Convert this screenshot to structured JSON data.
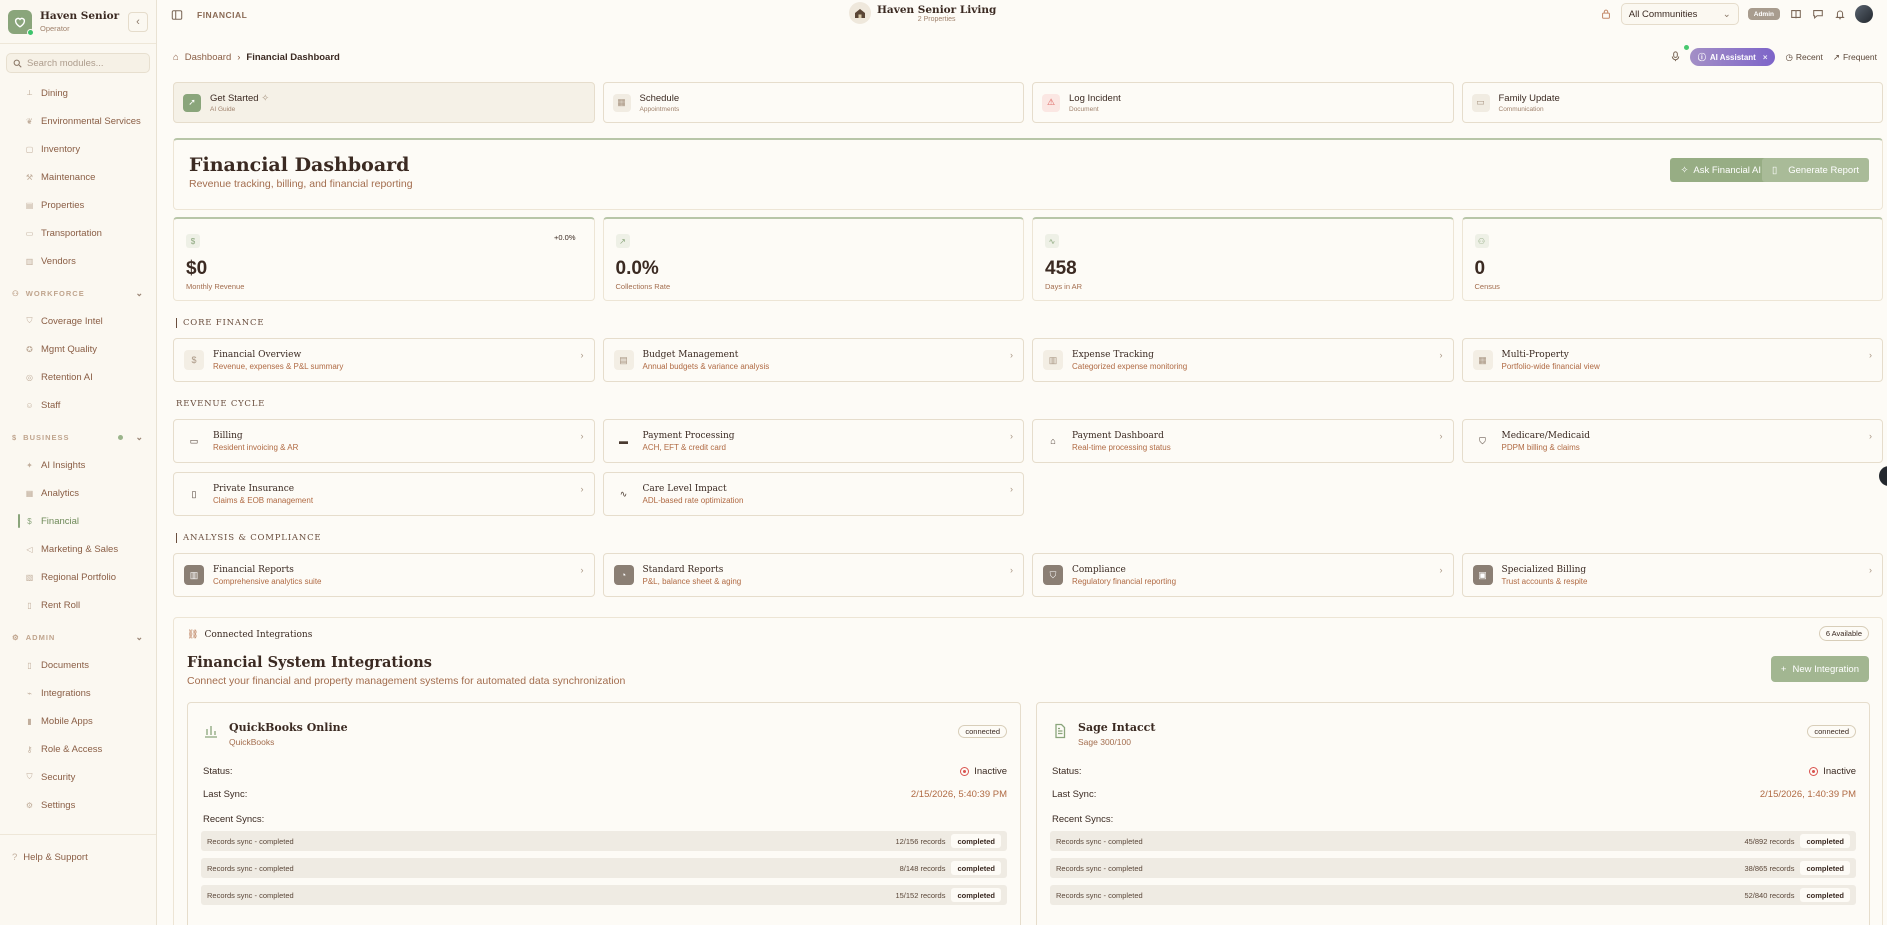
{
  "sidebar": {
    "org_name": "Haven Senior Livi...",
    "role": "Operator",
    "search_placeholder": "Search modules...",
    "top_items": [
      {
        "label": "Dining",
        "icon": "utensils-icon"
      },
      {
        "label": "Environmental Services",
        "icon": "leaf-icon"
      },
      {
        "label": "Inventory",
        "icon": "box-icon"
      },
      {
        "label": "Maintenance",
        "icon": "wrench-icon"
      },
      {
        "label": "Properties",
        "icon": "building-icon"
      },
      {
        "label": "Transportation",
        "icon": "truck-icon"
      },
      {
        "label": "Vendors",
        "icon": "store-icon"
      }
    ],
    "sections": [
      {
        "label": "WORKFORCE",
        "items": [
          {
            "label": "Coverage Intel"
          },
          {
            "label": "Mgmt Quality"
          },
          {
            "label": "Retention AI"
          },
          {
            "label": "Staff"
          }
        ]
      },
      {
        "label": "BUSINESS",
        "items": [
          {
            "label": "AI Insights"
          },
          {
            "label": "Analytics"
          },
          {
            "label": "Financial",
            "active": true
          },
          {
            "label": "Marketing & Sales"
          },
          {
            "label": "Regional Portfolio"
          },
          {
            "label": "Rent Roll"
          }
        ]
      },
      {
        "label": "ADMIN",
        "items": [
          {
            "label": "Documents"
          },
          {
            "label": "Integrations"
          },
          {
            "label": "Mobile Apps"
          },
          {
            "label": "Role & Access"
          },
          {
            "label": "Security"
          },
          {
            "label": "Settings"
          }
        ]
      }
    ],
    "help": "Help & Support"
  },
  "topbar": {
    "section": "FINANCIAL",
    "org": "Haven Senior Living",
    "properties": "2 Properties",
    "community": "All Communities",
    "badge": "Admin"
  },
  "breadcrumb": {
    "home": "Dashboard",
    "current": "Financial Dashboard",
    "ai_assistant": "AI Assistant",
    "recent": "Recent",
    "frequent": "Frequent"
  },
  "quick_actions": [
    {
      "title": "Get Started",
      "sub": "AI Guide"
    },
    {
      "title": "Schedule",
      "sub": "Appointments"
    },
    {
      "title": "Log Incident",
      "sub": "Document"
    },
    {
      "title": "Family Update",
      "sub": "Communication"
    }
  ],
  "hero": {
    "title": "Financial Dashboard",
    "subtitle": "Revenue tracking, billing, and financial reporting",
    "ask_ai": "Ask Financial AI",
    "generate": "Generate Report"
  },
  "kpis": [
    {
      "value": "$0",
      "label": "Monthly Revenue",
      "delta": "+0.0%"
    },
    {
      "value": "0.0%",
      "label": "Collections Rate",
      "delta": ""
    },
    {
      "value": "458",
      "label": "Days in AR",
      "delta": ""
    },
    {
      "value": "0",
      "label": "Census",
      "delta": ""
    }
  ],
  "core_finance": {
    "heading": "CORE FINANCE",
    "cards": [
      {
        "title": "Financial Overview",
        "sub": "Revenue, expenses & P&L summary"
      },
      {
        "title": "Budget Management",
        "sub": "Annual budgets & variance analysis"
      },
      {
        "title": "Expense Tracking",
        "sub": "Categorized expense monitoring"
      },
      {
        "title": "Multi-Property",
        "sub": "Portfolio-wide financial view"
      }
    ]
  },
  "revenue_cycle": {
    "heading": "REVENUE CYCLE",
    "cards": [
      {
        "title": "Billing",
        "sub": "Resident invoicing & AR"
      },
      {
        "title": "Payment Processing",
        "sub": "ACH, EFT & credit card"
      },
      {
        "title": "Payment Dashboard",
        "sub": "Real-time processing status"
      },
      {
        "title": "Medicare/Medicaid",
        "sub": "PDPM billing & claims"
      },
      {
        "title": "Private Insurance",
        "sub": "Claims & EOB management"
      },
      {
        "title": "Care Level Impact",
        "sub": "ADL-based rate optimization"
      }
    ]
  },
  "analysis": {
    "heading": "ANALYSIS & COMPLIANCE",
    "cards": [
      {
        "title": "Financial Reports",
        "sub": "Comprehensive analytics suite"
      },
      {
        "title": "Standard Reports",
        "sub": "P&L, balance sheet & aging"
      },
      {
        "title": "Compliance",
        "sub": "Regulatory financial reporting"
      },
      {
        "title": "Specialized Billing",
        "sub": "Trust accounts & respite"
      }
    ]
  },
  "integrations": {
    "label": "Connected Integrations",
    "available": "6 Available",
    "title": "Financial System Integrations",
    "subtitle": "Connect your financial and property management systems for automated data synchronization",
    "new_button": "New Integration",
    "status_label": "Status:",
    "last_sync_label": "Last Sync:",
    "recent_label": "Recent Syncs:",
    "cards": [
      {
        "name": "QuickBooks Online",
        "vendor": "QuickBooks",
        "badge": "connected",
        "status": "Inactive",
        "last_sync": "2/15/2026, 5:40:39 PM",
        "syncs": [
          {
            "label": "Records sync - completed",
            "records": "12/156 records",
            "state": "completed"
          },
          {
            "label": "Records sync - completed",
            "records": "8/148 records",
            "state": "completed"
          },
          {
            "label": "Records sync - completed",
            "records": "15/152 records",
            "state": "completed"
          }
        ]
      },
      {
        "name": "Sage Intacct",
        "vendor": "Sage 300/100",
        "badge": "connected",
        "status": "Inactive",
        "last_sync": "2/15/2026, 1:40:39 PM",
        "syncs": [
          {
            "label": "Records sync - completed",
            "records": "45/892 records",
            "state": "completed"
          },
          {
            "label": "Records sync - completed",
            "records": "38/865 records",
            "state": "completed"
          },
          {
            "label": "Records sync - completed",
            "records": "52/840 records",
            "state": "completed"
          }
        ]
      }
    ]
  }
}
